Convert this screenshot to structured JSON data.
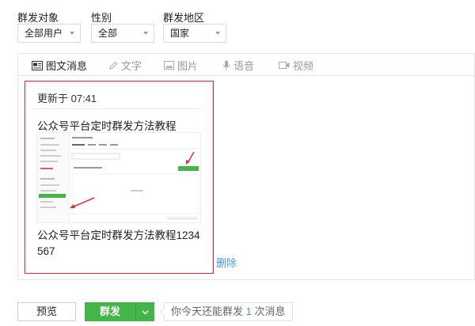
{
  "filters": {
    "target": {
      "label": "群发对象",
      "value": "全部用户"
    },
    "gender": {
      "label": "性别",
      "value": "全部"
    },
    "region": {
      "label": "群发地区",
      "value": "国家"
    }
  },
  "tabs": [
    {
      "label": "图文消息",
      "icon": "news-icon",
      "active": true
    },
    {
      "label": "文字",
      "icon": "pencil-icon",
      "active": false
    },
    {
      "label": "图片",
      "icon": "image-icon",
      "active": false
    },
    {
      "label": "语音",
      "icon": "microphone-icon",
      "active": false
    },
    {
      "label": "视频",
      "icon": "video-icon",
      "active": false
    }
  ],
  "article": {
    "updated": "更新于 07:41",
    "title": "公众号平台定时群发方法教程",
    "summary": "公众号平台定时群发方法教程1234567",
    "delete_label": "删除"
  },
  "actions": {
    "preview_label": "预览",
    "send_label": "群发",
    "quota_prefix": "你今天还能群发",
    "quota_count": "1",
    "quota_suffix": "次消息"
  },
  "colors": {
    "accent_green": "#44b549",
    "highlight_red": "#d9272e",
    "link_blue": "#459ae9"
  }
}
